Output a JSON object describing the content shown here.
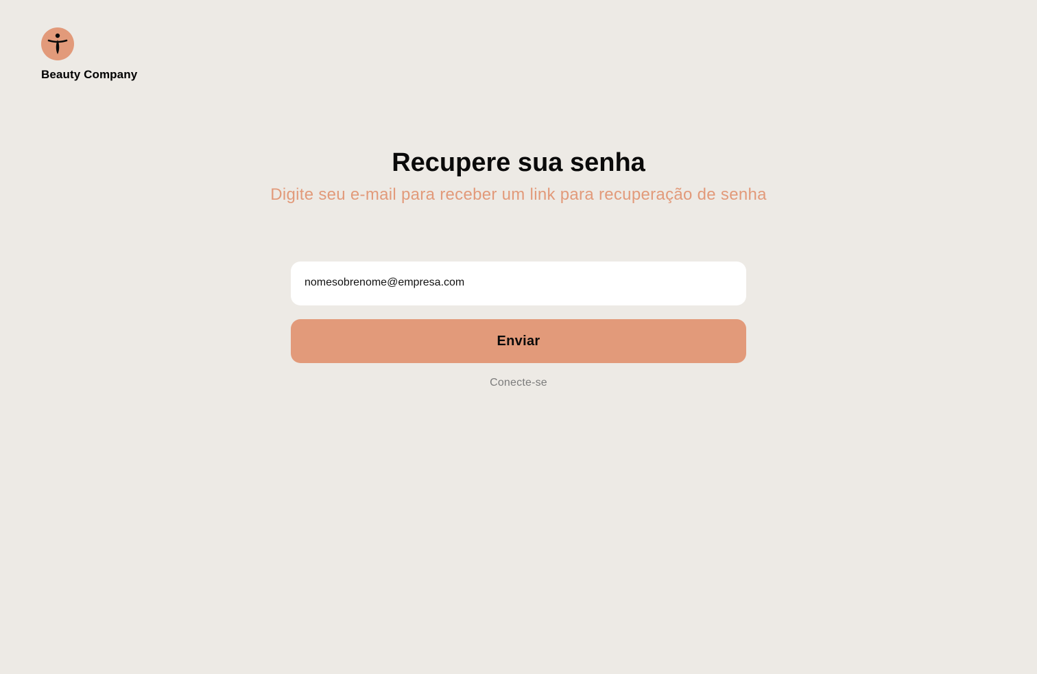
{
  "brand": {
    "name": "Beauty Company",
    "logo_icon": "person-figure-icon",
    "accent_color": "#E29A7A"
  },
  "page": {
    "title": "Recupere sua senha",
    "subtitle": "Digite seu e-mail para receber um link para recuperação de senha"
  },
  "form": {
    "email_value": "nomesobrenome@empresa.com",
    "submit_label": "Enviar",
    "login_link_label": "Conecte-se"
  },
  "colors": {
    "background": "#EDEAE5",
    "accent": "#E29A7A",
    "muted_text": "#7B7B7B"
  }
}
